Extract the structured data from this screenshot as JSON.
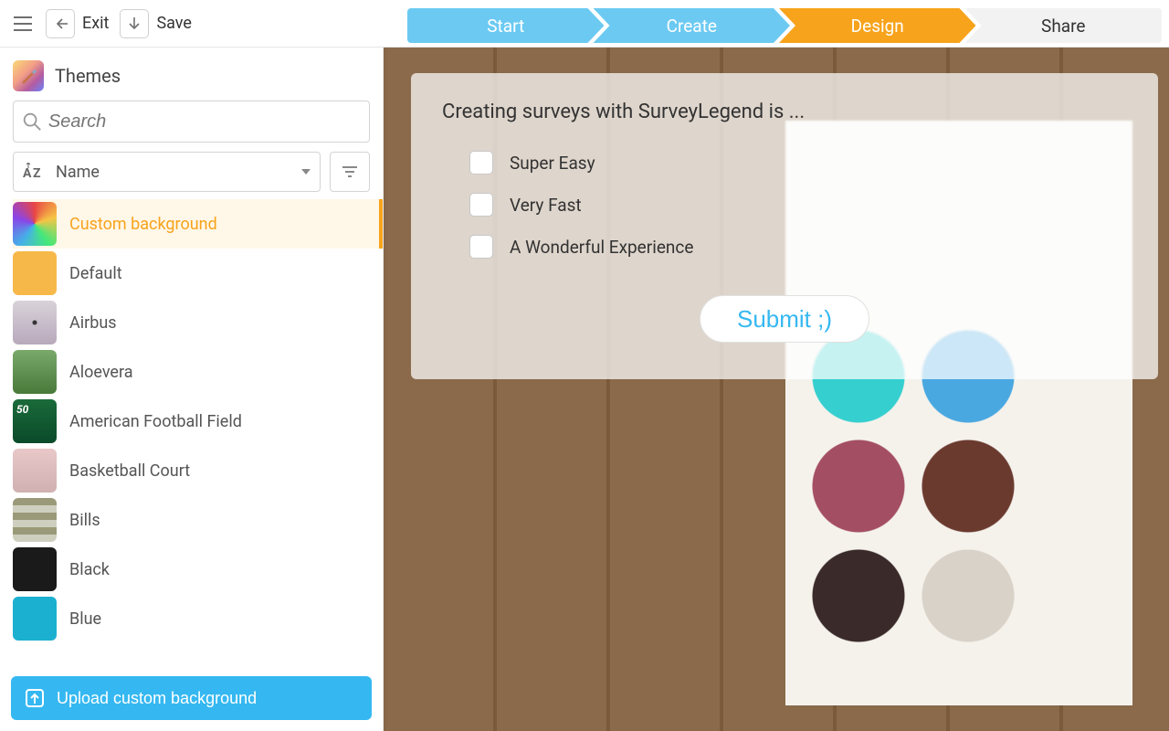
{
  "toolbar": {
    "exit_label": "Exit",
    "save_label": "Save"
  },
  "steps": [
    "Start",
    "Create",
    "Design",
    "Share"
  ],
  "active_step": 2,
  "sidebar": {
    "title": "Themes",
    "search_placeholder": "Search",
    "sort_label": "Name",
    "upload_label": "Upload custom background",
    "themes": [
      {
        "label": "Custom background",
        "thumb": "tpalette",
        "active": true
      },
      {
        "label": "Default",
        "thumb": "tdefault"
      },
      {
        "label": "Airbus",
        "thumb": "tairbus"
      },
      {
        "label": "Aloevera",
        "thumb": "taloe"
      },
      {
        "label": "American Football Field",
        "thumb": "tfootball"
      },
      {
        "label": "Basketball Court",
        "thumb": "tbasket"
      },
      {
        "label": "Bills",
        "thumb": "tbills"
      },
      {
        "label": "Black",
        "thumb": "tblack"
      },
      {
        "label": "Blue",
        "thumb": "tblue"
      }
    ]
  },
  "survey": {
    "question": "Creating surveys with SurveyLegend is ...",
    "options": [
      "Super Easy",
      "Very Fast",
      "A Wonderful Experience"
    ],
    "submit_label": "Submit ;)"
  }
}
